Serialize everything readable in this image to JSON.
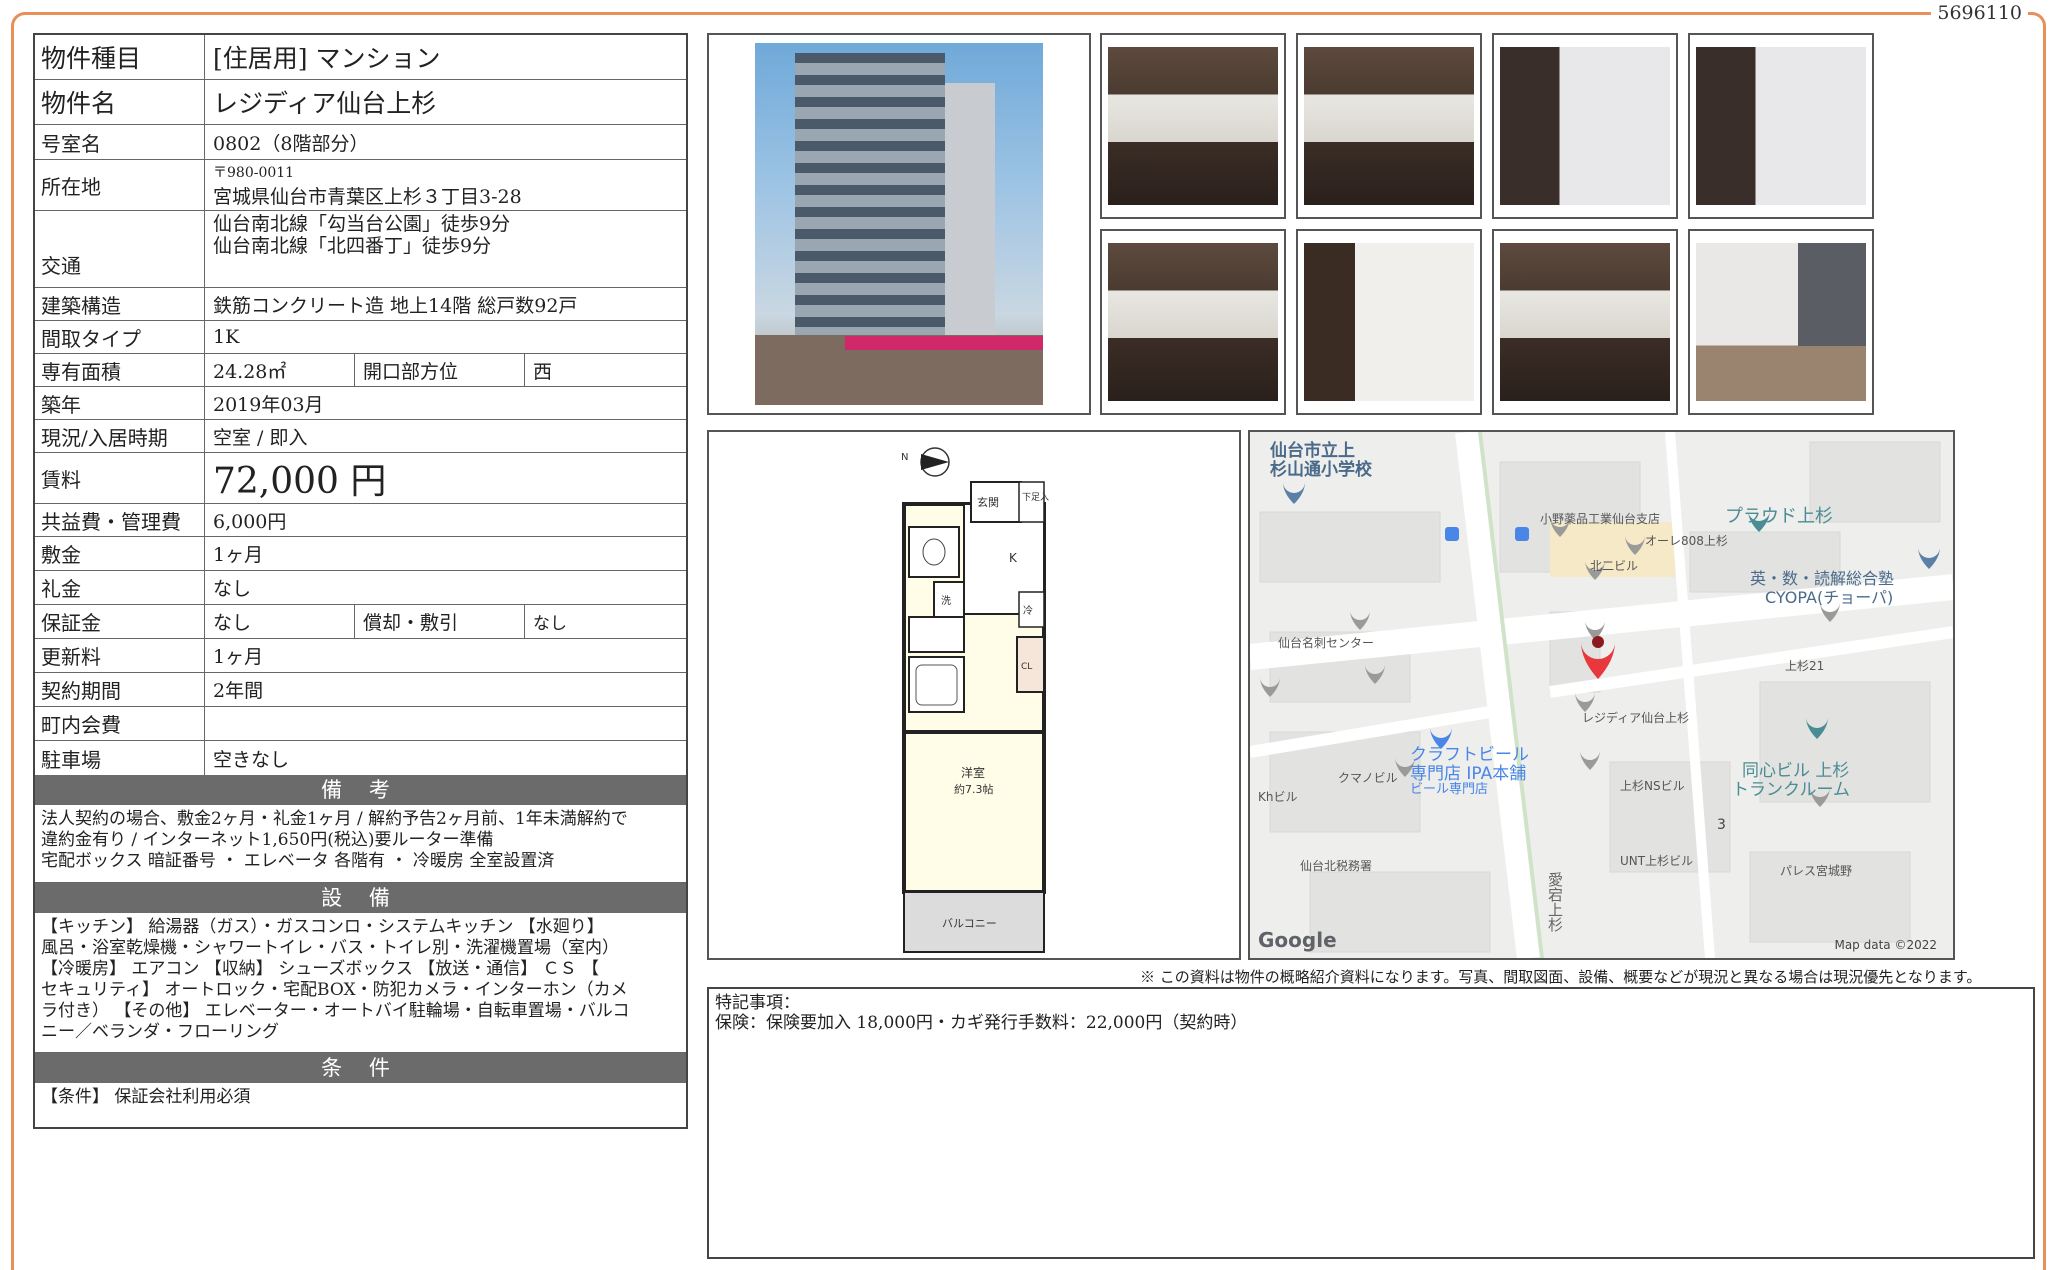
{
  "page_id": "5696110",
  "info": {
    "type_label": "物件種目",
    "type_value": "[住居用] マンション",
    "name_label": "物件名",
    "name_value": "レジディア仙台上杉",
    "room_label": "号室名",
    "room_value": "0802（8階部分）",
    "address_label": "所在地",
    "postal": "〒980-0011",
    "address": "宮城県仙台市青葉区上杉３丁目3-28",
    "access_label": "交通",
    "access_1": "仙台南北線「勾当台公園」徒歩9分",
    "access_2": "仙台南北線「北四番丁」徒歩9分",
    "structure_label": "建築構造",
    "structure_value": "鉄筋コンクリート造 地上14階 総戸数92戸",
    "layout_label": "間取タイプ",
    "layout_value": "1K",
    "area_label": "専有面積",
    "area_value": "24.28㎡",
    "direction_label": "開口部方位",
    "direction_value": "西",
    "built_label": "築年",
    "built_value": "2019年03月",
    "status_label": "現況/入居時期",
    "status_value": "空室 / 即入",
    "rent_label": "賃料",
    "rent_value": "72,000 円",
    "fee_label": "共益費・管理費",
    "fee_value": "6,000円",
    "deposit_label": "敷金",
    "deposit_value": "1ヶ月",
    "key_money_label": "礼金",
    "key_money_value": "なし",
    "guarantee_label": "保証金",
    "guarantee_value": "なし",
    "amort_label": "償却・敷引",
    "amort_value": "なし",
    "renewal_label": "更新料",
    "renewal_value": "1ヶ月",
    "term_label": "契約期間",
    "term_value": "2年間",
    "assoc_label": "町内会費",
    "assoc_value": "",
    "parking_label": "駐車場",
    "parking_value": "空きなし"
  },
  "remarks": {
    "title": "備 考",
    "lines": [
      "法人契約の場合、敷金2ヶ月・礼金1ヶ月 / 解約予告2ヶ月前、1年未満解約で",
      "違約金有り / インターネット1,650円(税込)要ルーター準備",
      "宅配ボックス 暗証番号 ・ エレベータ 各階有 ・ 冷暖房 全室設置済"
    ]
  },
  "equipment": {
    "title": "設 備",
    "lines": [
      "【キッチン】 給湯器（ガス）・ガスコンロ・システムキッチン 【水廻り】",
      "風呂・浴室乾燥機・シャワートイレ・バス・トイレ別・洗濯機置場（室内）",
      "【冷暖房】 エアコン 【収納】 シューズボックス 【放送・通信】 ＣＳ 【",
      "セキュリティ】 オートロック・宅配BOX・防犯カメラ・インターホン（カメ",
      "ラ付き） 【その他】 エレベーター・オートバイ駐輪場・自転車置場・バルコ",
      "ニー／ベランダ・フローリング"
    ]
  },
  "conditions": {
    "title": "条 件",
    "text": "【条件】 保証会社利用必須"
  },
  "floorplan": {
    "entrance": "玄関",
    "shoebox": "下足入",
    "kitchen": "K",
    "wash": "洗",
    "fridge": "冷",
    "closet": "CL",
    "room": "洋室",
    "room_size": "約7.3帖",
    "balcony": "バルコニー",
    "north": "N"
  },
  "map": {
    "labels": {
      "school": "仙台市立上\n杉山通小学校",
      "ono": "小野薬品工業仙台支店",
      "proud": "プラウド上杉",
      "ore": "オーレ808上杉",
      "kita2": "北二ビル",
      "cyopa_1": "英・数・読解総合塾",
      "cyopa_2": "CYOPA(チョーパ)",
      "meishi": "仙台名刺センター",
      "uesugi21": "上杉21",
      "residia": "レジディア仙台上杉",
      "craft_1": "クラフトビール",
      "craft_2": "専門店 IPA本舗",
      "craft_3": "ビール専門店",
      "kumano": "クマノビル",
      "kh": "Khビル",
      "ns": "上杉NSビル",
      "doshin_1": "同心ビル 上杉",
      "doshin_2": "トランクルーム",
      "block": "3",
      "zeimusho": "仙台北税務署",
      "unt": "UNT上杉ビル",
      "palace": "パレス宮城野",
      "street": "愛宕上杉",
      "google": "Google",
      "mapdata": "Map data ©2022"
    }
  },
  "disclaimer": "※ この資料は物件の概略紹介資料になります。写真、間取図面、設備、概要などが現況と異なる場合は現況優先となります。",
  "special": {
    "title": "特記事項：",
    "text": "保険：保険要加入 18,000円・カギ発行手数料：22,000円（契約時）"
  },
  "colors": {
    "frame": "#e8905a",
    "section_head": "#6b6b6b",
    "map_pin": "#e8383d"
  }
}
